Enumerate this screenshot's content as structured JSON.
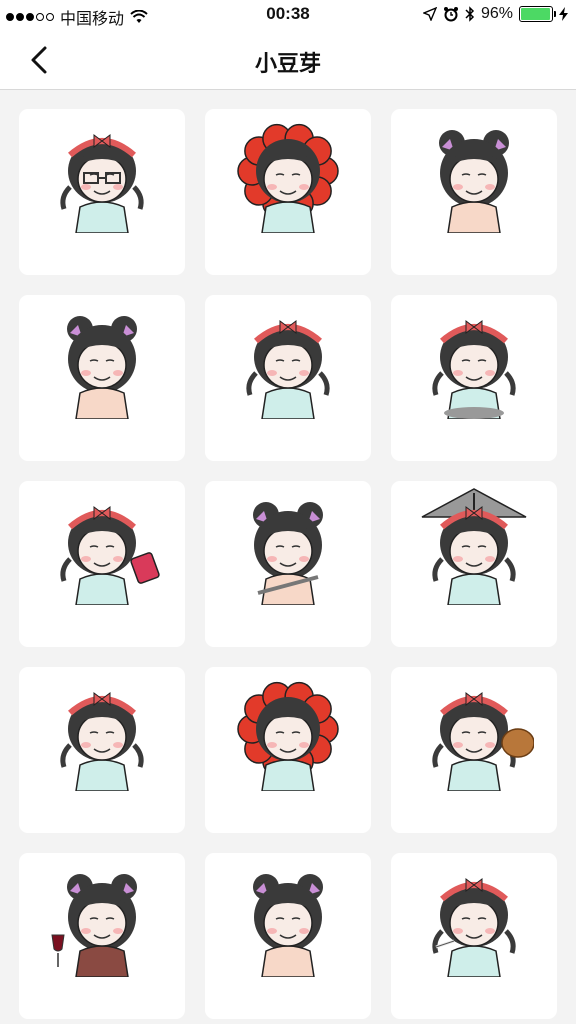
{
  "status_bar": {
    "carrier": "中国移动",
    "time": "00:38",
    "battery_percent": "96%",
    "battery_level": 0.96,
    "icons": [
      "signal-icon",
      "wifi-icon",
      "location-icon",
      "alarm-icon",
      "bluetooth-icon",
      "battery-icon",
      "charging-icon"
    ]
  },
  "nav": {
    "title": "小豆芽",
    "back_icon": "chevron-left-icon"
  },
  "stickers": [
    {
      "label": "girl-headband-glasses",
      "hair": "bob",
      "accessory": "glasses"
    },
    {
      "label": "girl-flower-hood-laughing",
      "hair": "flower",
      "accessory": "none"
    },
    {
      "label": "girl-buns-pointing",
      "hair": "buns",
      "accessory": "none"
    },
    {
      "label": "girl-buns-middle-finger",
      "hair": "buns",
      "accessory": "none"
    },
    {
      "label": "girl-headband-smug",
      "hair": "bob",
      "accessory": "none"
    },
    {
      "label": "girl-headband-crying-sitting",
      "hair": "bob",
      "accessory": "shadow"
    },
    {
      "label": "girl-headband-red-card",
      "hair": "bob",
      "accessory": "card"
    },
    {
      "label": "girl-buns-knife",
      "hair": "buns",
      "accessory": "knife"
    },
    {
      "label": "girl-umbrella-crying",
      "hair": "bob",
      "accessory": "umbrella"
    },
    {
      "label": "girl-headband-braids",
      "hair": "bob",
      "accessory": "none"
    },
    {
      "label": "girl-flower-hood-cute",
      "hair": "flower",
      "accessory": "none"
    },
    {
      "label": "girl-headband-potato",
      "hair": "bob",
      "accessory": "potato"
    },
    {
      "label": "girl-buns-wine",
      "hair": "buns",
      "accessory": "wine"
    },
    {
      "label": "girl-buns-pointing-2",
      "hair": "buns",
      "accessory": "none"
    },
    {
      "label": "girl-headband-smoking",
      "hair": "bob",
      "accessory": "cigarette"
    }
  ],
  "colors": {
    "background": "#f3f3f3",
    "tile": "#ffffff",
    "hair": "#3a3a3a",
    "headband": "#e05a5a",
    "flower": "#e23a2a",
    "shirt": "#cfeeea",
    "battery": "#4cd964"
  }
}
